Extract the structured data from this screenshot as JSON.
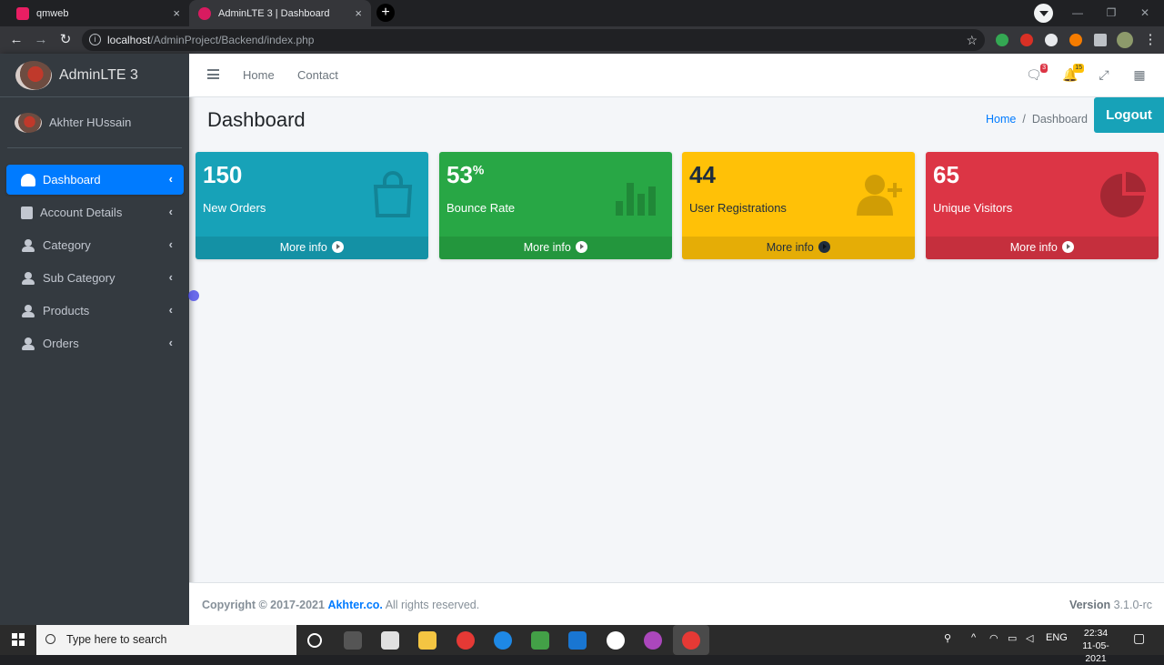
{
  "browser": {
    "tabs": [
      {
        "title": "qmweb",
        "close": "×",
        "active": false
      },
      {
        "title": "AdminLTE 3 | Dashboard",
        "close": "×",
        "active": true
      }
    ],
    "new_tab": "+",
    "url_host": "localhost",
    "url_path": "/AdminProject/Backend/index.php",
    "nav": {
      "back": "←",
      "forward": "→",
      "reload": "↻",
      "bookmark": "☆"
    }
  },
  "sidebar": {
    "brand": "AdminLTE 3",
    "user_name": "Akhter HUssain",
    "items": [
      {
        "label": "Dashboard",
        "icon": "tachometer-icon",
        "active": true
      },
      {
        "label": "Account Details",
        "icon": "id-card-icon",
        "active": false
      },
      {
        "label": "Category",
        "icon": "users-icon",
        "active": false
      },
      {
        "label": "Sub Category",
        "icon": "users-icon",
        "active": false
      },
      {
        "label": "Products",
        "icon": "users-icon",
        "active": false
      },
      {
        "label": "Orders",
        "icon": "users-icon",
        "active": false
      }
    ],
    "chevron": "‹"
  },
  "topnav": {
    "home": "Home",
    "contact": "Contact",
    "messages_badge": "3",
    "notifications_badge": "15"
  },
  "header": {
    "title": "Dashboard",
    "breadcrumb_home": "Home",
    "breadcrumb_sep": "/",
    "breadcrumb_current": "Dashboard",
    "logout": "Logout"
  },
  "boxes": [
    {
      "value": "150",
      "suffix": "",
      "label": "New Orders",
      "more": "More info",
      "color": "#17a2b8",
      "icon": "shopping-bag-icon"
    },
    {
      "value": "53",
      "suffix": "%",
      "label": "Bounce Rate",
      "more": "More info",
      "color": "#28a745",
      "icon": "bar-chart-icon"
    },
    {
      "value": "44",
      "suffix": "",
      "label": "User Registrations",
      "more": "More info",
      "color": "#ffc107",
      "icon": "user-plus-icon"
    },
    {
      "value": "65",
      "suffix": "",
      "label": "Unique Visitors",
      "more": "More info",
      "color": "#dc3545",
      "icon": "pie-chart-icon"
    }
  ],
  "footer": {
    "copyright_prefix": "Copyright © 2017-2021",
    "company": "Akhter.co.",
    "rights": "All rights reserved.",
    "version_label": "Version",
    "version": "3.1.0-rc"
  },
  "taskbar": {
    "search_placeholder": "Type here to search",
    "language": "ENG",
    "time": "22:34",
    "date": "11-05-2021"
  }
}
